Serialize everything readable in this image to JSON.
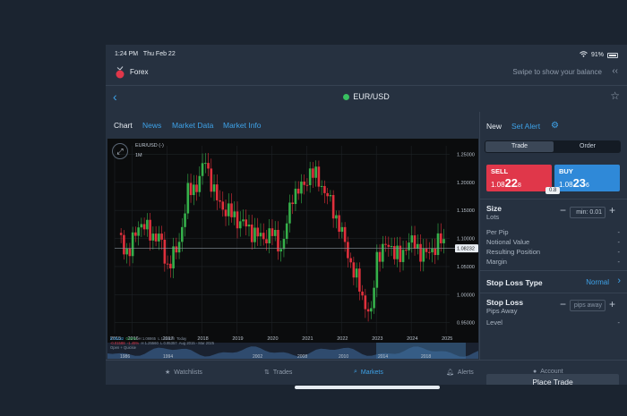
{
  "status": {
    "time": "1:24 PM",
    "date": "Thu Feb 22",
    "battery": "91%"
  },
  "app": {
    "name": "Forex",
    "swipe_hint": "Swipe to show your balance",
    "swipe_icon": "double-chevron-left-icon"
  },
  "header": {
    "symbol": "EUR/USD",
    "symbol_status_color": "#38c060"
  },
  "tabs": [
    {
      "label": "Chart",
      "active": true
    },
    {
      "label": "News"
    },
    {
      "label": "Market Data"
    },
    {
      "label": "Market Info"
    }
  ],
  "chart_overlay": {
    "title": "EUR/USD (-)",
    "timeframe": "1M",
    "stats_row1": [
      "0.00442",
      "0.04%",
      "H 1.08865",
      "L 1.08028",
      "Today"
    ],
    "stats_row2": [
      "-0.01588",
      "-1.45%",
      "H 1.25560",
      "L 0.95357",
      "Aug 2015 - Mar 2025"
    ],
    "stats_row3": "Open + Quickie",
    "current_price": "1.08232"
  },
  "chart_data": {
    "type": "candlestick",
    "title": "EUR/USD (-)",
    "interval": "1M",
    "y_ticks": [
      "1.25000",
      "1.20000",
      "1.15000",
      "1.10000",
      "1.05000",
      "1.00000",
      "0.95000"
    ],
    "ylim": [
      0.94,
      1.265
    ],
    "x_ticks": [
      "2015",
      "2016",
      "2017",
      "2018",
      "2019",
      "2020",
      "2021",
      "2022",
      "2023",
      "2024",
      "2025"
    ],
    "x_tick_years": [
      2015.5,
      2016,
      2017,
      2018,
      2019,
      2020,
      2021,
      2022,
      2023,
      2024,
      2025
    ],
    "navigator_ticks": [
      "1986",
      "1994",
      "2002",
      "2008",
      "2010",
      "2014",
      "2018"
    ],
    "current_price": 1.08232,
    "close_path": [
      [
        2015.6,
        1.11
      ],
      [
        2015.9,
        1.07
      ],
      [
        2016.2,
        1.13
      ],
      [
        2016.5,
        1.11
      ],
      [
        2016.8,
        1.1
      ],
      [
        2017.0,
        1.05
      ],
      [
        2017.3,
        1.08
      ],
      [
        2017.6,
        1.18
      ],
      [
        2017.9,
        1.2
      ],
      [
        2018.1,
        1.24
      ],
      [
        2018.4,
        1.17
      ],
      [
        2018.7,
        1.15
      ],
      [
        2018.9,
        1.14
      ],
      [
        2019.3,
        1.12
      ],
      [
        2019.7,
        1.1
      ],
      [
        2020.0,
        1.11
      ],
      [
        2020.3,
        1.08
      ],
      [
        2020.6,
        1.18
      ],
      [
        2020.9,
        1.19
      ],
      [
        2021.1,
        1.22
      ],
      [
        2021.4,
        1.2
      ],
      [
        2021.7,
        1.16
      ],
      [
        2021.9,
        1.13
      ],
      [
        2022.3,
        1.05
      ],
      [
        2022.7,
        0.98
      ],
      [
        2022.85,
        0.96
      ],
      [
        2023.0,
        1.07
      ],
      [
        2023.4,
        1.09
      ],
      [
        2023.7,
        1.06
      ],
      [
        2023.9,
        1.1
      ],
      [
        2024.2,
        1.08
      ],
      [
        2024.5,
        1.07
      ],
      [
        2024.8,
        1.1
      ],
      [
        2025.0,
        1.08
      ]
    ]
  },
  "side": {
    "new_label": "New",
    "set_alert_label": "Set Alert",
    "segment": [
      "Trade",
      "Order"
    ],
    "sell": {
      "label": "SELL",
      "price_pre": "1.08",
      "price_big": "22",
      "price_sup": "8",
      "color": "#e0374a"
    },
    "buy": {
      "label": "BUY",
      "price_pre": "1.08",
      "price_big": "23",
      "price_sup": "6",
      "color": "#2f89d8"
    },
    "spread": "0.8",
    "size": {
      "label": "Size",
      "unit": "Lots",
      "value": "min: 0.01"
    },
    "details": [
      {
        "label": "Per Pip",
        "value": "-"
      },
      {
        "label": "Notional Value",
        "value": "-"
      },
      {
        "label": "Resulting Position",
        "value": "-"
      },
      {
        "label": "Margin",
        "value": "-"
      }
    ],
    "stop_loss_type": {
      "label": "Stop Loss Type",
      "value": "Normal"
    },
    "stop_loss": {
      "label": "Stop Loss",
      "unit": "Pips Away",
      "placeholder": "pips away"
    },
    "level": {
      "label": "Level",
      "value": "-"
    },
    "place_trade": "Place Trade"
  },
  "nav": [
    {
      "label": "Watchlists",
      "icon": "star-icon"
    },
    {
      "label": "Trades",
      "icon": "arrows-icon"
    },
    {
      "label": "Markets",
      "icon": "search-icon",
      "active": true
    },
    {
      "label": "Alerts",
      "icon": "bell-icon"
    },
    {
      "label": "Account",
      "icon": "user-icon"
    }
  ]
}
